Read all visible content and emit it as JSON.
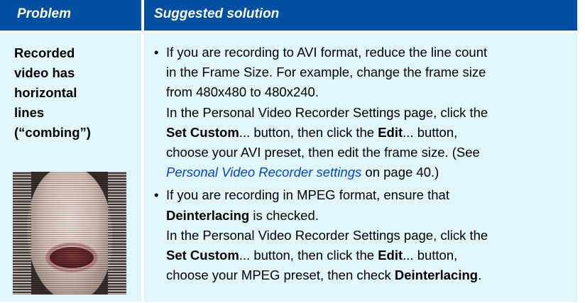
{
  "table": {
    "headers": {
      "problem": "Problem",
      "solution": "Suggested solution"
    },
    "row": {
      "problem_lines": [
        "Recorded",
        "video has",
        "horizontal",
        "lines",
        "(“combing”)"
      ],
      "image_alt": "combing artifact example",
      "solutions": [
        {
          "lines": [
            [
              {
                "t": "If you are recording to AVI format, reduce the line count",
                "s": "n"
              }
            ],
            [
              {
                "t": "in the Frame Size.  For example, change the frame size",
                "s": "n"
              }
            ],
            [
              {
                "t": "from 480x480 to 480x240.",
                "s": "n"
              }
            ],
            [
              {
                "t": "In the Personal Video Recorder Settings page, click the",
                "s": "n"
              }
            ],
            [
              {
                "t": "Set Custom",
                "s": "b"
              },
              {
                "t": "... button, then click the ",
                "s": "n"
              },
              {
                "t": "Edit",
                "s": "b"
              },
              {
                "t": "... button,",
                "s": "n"
              }
            ],
            [
              {
                "t": "choose your AVI preset, then edit the frame size.  (See",
                "s": "n"
              }
            ],
            [
              {
                "t": "Personal Video Recorder settings",
                "s": "link"
              },
              {
                "t": " on page 40.)",
                "s": "n"
              }
            ]
          ]
        },
        {
          "lines": [
            [
              {
                "t": "If you are recording in MPEG format, ensure that",
                "s": "n"
              }
            ],
            [
              {
                "t": "Deinterlacing",
                "s": "b"
              },
              {
                "t": " is checked.",
                "s": "n"
              }
            ],
            [
              {
                "t": "In the Personal Video Recorder Settings page, click the",
                "s": "n"
              }
            ],
            [
              {
                "t": "Set Custom",
                "s": "b"
              },
              {
                "t": "... button, then click the ",
                "s": "n"
              },
              {
                "t": "Edit",
                "s": "b"
              },
              {
                "t": "... button,",
                "s": "n"
              }
            ],
            [
              {
                "t": "choose your MPEG preset, then check ",
                "s": "n"
              },
              {
                "t": "Deinterlacing",
                "s": "b"
              },
              {
                "t": ".",
                "s": "n"
              }
            ]
          ]
        }
      ]
    }
  },
  "colors": {
    "header_bg": "#004fa3",
    "cell_bg": "#e1f6fb",
    "link": "#0047c8"
  }
}
